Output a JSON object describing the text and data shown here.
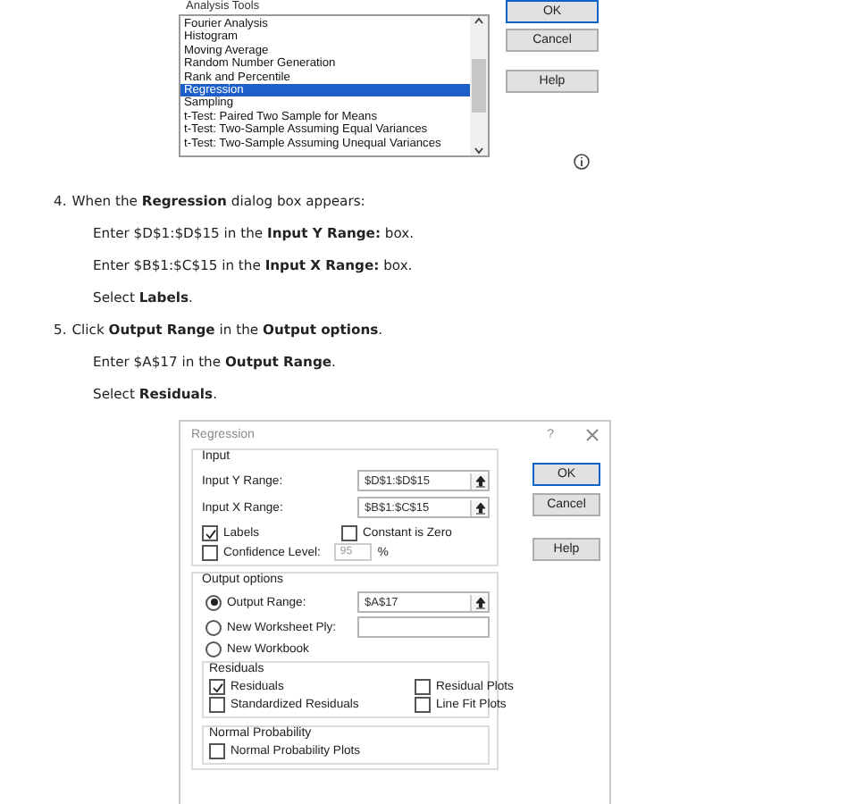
{
  "analysis_tools": {
    "label": "Analysis Tools",
    "items": [
      {
        "text": "Fourier Analysis",
        "selected": false
      },
      {
        "text": "Histogram",
        "selected": false
      },
      {
        "text": "Moving Average",
        "selected": false
      },
      {
        "text": "Random Number Generation",
        "selected": false
      },
      {
        "text": "Rank and Percentile",
        "selected": false
      },
      {
        "text": "Regression",
        "selected": true
      },
      {
        "text": "Sampling",
        "selected": false
      },
      {
        "text": "t-Test: Paired Two Sample for Means",
        "selected": false
      },
      {
        "text": "t-Test: Two-Sample Assuming Equal Variances",
        "selected": false
      },
      {
        "text": "t-Test: Two-Sample Assuming Unequal Variances",
        "selected": false
      }
    ],
    "buttons": [
      {
        "label": "OK",
        "default": true
      },
      {
        "label": "Cancel",
        "default": false
      },
      {
        "label": "Help",
        "default": false
      }
    ]
  },
  "steps": [
    {
      "kind": "numbered",
      "number": "4.",
      "text": "When the **Regression** dialog box appears:"
    },
    {
      "kind": "sub",
      "text": "Enter $D$1:$D$15 in the **Input Y Range:** box."
    },
    {
      "kind": "sub",
      "text": "Enter $B$1:$C$15 in the **Input X Range:** box."
    },
    {
      "kind": "sub",
      "text": "Select **Labels**."
    },
    {
      "kind": "numbered",
      "number": "5.",
      "text": "Click **Output Range** in the **Output options**."
    },
    {
      "kind": "sub",
      "text": "Enter $A$17 in the **Output Range**."
    },
    {
      "kind": "sub",
      "text": "Select **Residuals**."
    }
  ],
  "regression_dialog": {
    "title": "Regression",
    "help_mark": "?",
    "input": {
      "label": "Input",
      "fields": [
        {
          "label": "Input Y Range:",
          "value": "$D$1:$D$15"
        },
        {
          "label": "Input X Range:",
          "value": "$B$1:$C$15"
        }
      ],
      "labels": {
        "label": "Labels",
        "checked": true
      },
      "constant_is_zero": {
        "label": "Constant is Zero",
        "checked": false
      },
      "confidence": {
        "label": "Confidence Level:",
        "checked": false,
        "value": "95",
        "disabled": true,
        "unit": "%"
      }
    },
    "buttons": [
      {
        "label": "OK",
        "default": true
      },
      {
        "label": "Cancel",
        "default": false
      },
      {
        "label": "Help",
        "default": false
      }
    ],
    "output": {
      "label": "Output options",
      "options": [
        {
          "label": "Output Range:",
          "selected": true,
          "value": "$A$17",
          "kind": "ref"
        },
        {
          "label": "New Worksheet Ply:",
          "selected": false,
          "kind": "text"
        },
        {
          "label": "New Workbook",
          "selected": false,
          "kind": "plain"
        }
      ]
    },
    "residuals": {
      "label": "Residuals",
      "checkboxes": [
        {
          "label": "Residuals",
          "checked": true
        },
        {
          "label": "Residual Plots",
          "checked": false
        },
        {
          "label": "Standardized Residuals",
          "checked": false
        },
        {
          "label": "Line Fit Plots",
          "checked": false
        }
      ]
    },
    "normal_probability": {
      "label": "Normal Probability",
      "checkboxes": [
        {
          "label": "Normal Probability Plots",
          "checked": false
        }
      ]
    }
  }
}
